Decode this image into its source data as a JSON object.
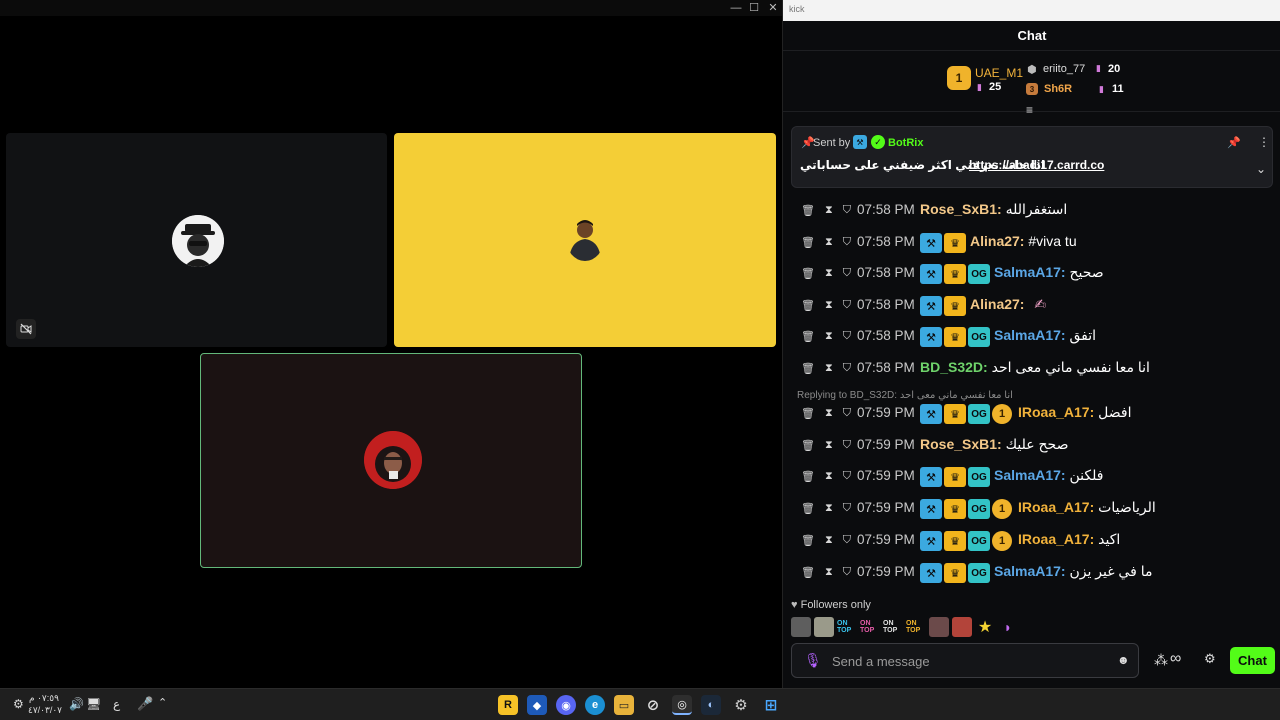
{
  "call_window": {
    "controls": {
      "minimize": "—",
      "maximize": "☐",
      "close": "✕"
    }
  },
  "chat_window": {
    "titlebar_label": "kick",
    "header_title": "Chat",
    "leaderboard": {
      "first": {
        "rank": "1",
        "name": "UAE_M1",
        "count": "25"
      },
      "second": {
        "name": "eriito_77",
        "count": "20"
      },
      "third": {
        "rank": "3",
        "name": "Sh6R",
        "count": "11"
      }
    },
    "pinned": {
      "sent_by_label": "Sent by",
      "sender": "BotRix",
      "text": "اذا حاب تعرفني اكثر ضيفني على حساباتي",
      "link": "https://abadi17.carrd.co"
    },
    "messages": [
      {
        "time": "07:58 PM",
        "user": "Rose_SxB1:",
        "user_color": "#f3c889",
        "text": "استغفرالله",
        "badges": []
      },
      {
        "time": "07:58 PM",
        "user": "Alina27:",
        "user_color": "#f3c889",
        "text": "#viva tu",
        "badges": [
          "mod",
          "crown"
        ]
      },
      {
        "time": "07:58 PM",
        "user": "SalmaA17:",
        "user_color": "#5ba7e6",
        "text": "صحيح",
        "badges": [
          "mod",
          "crown",
          "og"
        ]
      },
      {
        "time": "07:58 PM",
        "user": "Alina27:",
        "user_color": "#f3c889",
        "text": "",
        "badges": [
          "mod",
          "crown"
        ]
      },
      {
        "time": "07:58 PM",
        "user": "SalmaA17:",
        "user_color": "#5ba7e6",
        "text": "اتفق",
        "badges": [
          "mod",
          "crown",
          "og"
        ]
      },
      {
        "time": "07:58 PM",
        "user": "BD_S32D:",
        "user_color": "#6fd36b",
        "text": "انا معا نفسي ماني معى احد",
        "badges": []
      },
      {
        "time": "07:59 PM",
        "user": "IRoaa_A17:",
        "user_color": "#f1b23b",
        "text": "افضل",
        "badges": [
          "mod",
          "crown",
          "og",
          "gift"
        ],
        "reply": "Replying to BD_S32D: انا معا نفسي ماني معى احد"
      },
      {
        "time": "07:59 PM",
        "user": "Rose_SxB1:",
        "user_color": "#f3c889",
        "text": "صحح عليك",
        "badges": []
      },
      {
        "time": "07:59 PM",
        "user": "SalmaA17:",
        "user_color": "#5ba7e6",
        "text": "فلكنن",
        "badges": [
          "mod",
          "crown",
          "og"
        ]
      },
      {
        "time": "07:59 PM",
        "user": "IRoaa_A17:",
        "user_color": "#f1b23b",
        "text": "الرياضيات",
        "badges": [
          "mod",
          "crown",
          "og",
          "gift"
        ]
      },
      {
        "time": "07:59 PM",
        "user": "IRoaa_A17:",
        "user_color": "#f1b23b",
        "text": "اكيد",
        "badges": [
          "mod",
          "crown",
          "og",
          "gift"
        ]
      },
      {
        "time": "07:59 PM",
        "user": "SalmaA17:",
        "user_color": "#5ba7e6",
        "text": "ما في غير يزن",
        "badges": [
          "mod",
          "crown",
          "og"
        ]
      }
    ],
    "followers_only": "Followers only",
    "emotes": [
      "ON TOP",
      "ON TOP",
      "ON TOP",
      "ON TOP"
    ],
    "input_placeholder": "Send a message",
    "send_label": "Chat"
  },
  "taskbar": {
    "clock_time": "٠٧:٥٩ م",
    "clock_date": "٤٧/٠٣/٠٧",
    "lang": "ع"
  },
  "colors": {
    "accent_green": "#53fc18",
    "tile_yellow": "#f4ce36",
    "active_border": "#63b87a"
  }
}
